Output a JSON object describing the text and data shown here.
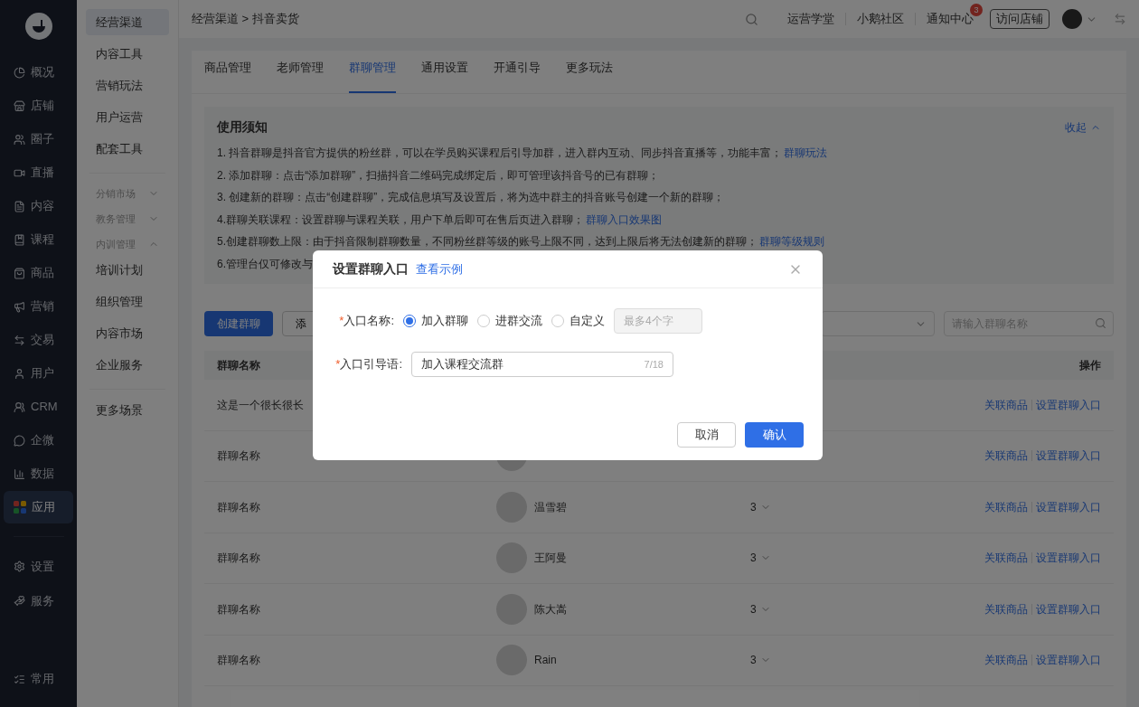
{
  "main_nav": {
    "items": [
      {
        "label": "概况",
        "selected": false
      },
      {
        "label": "店铺",
        "selected": false
      },
      {
        "label": "圈子",
        "selected": false
      },
      {
        "label": "直播",
        "selected": false
      },
      {
        "label": "内容",
        "selected": false
      },
      {
        "label": "课程",
        "selected": false
      },
      {
        "label": "商品",
        "selected": false
      },
      {
        "label": "营销",
        "selected": false
      },
      {
        "label": "交易",
        "selected": false
      },
      {
        "label": "用户",
        "selected": false
      },
      {
        "label": "CRM",
        "selected": false
      },
      {
        "label": "企微",
        "selected": false
      },
      {
        "label": "数据",
        "selected": false
      },
      {
        "label": "应用",
        "selected": true
      }
    ],
    "bottom_items": [
      {
        "label": "设置"
      },
      {
        "label": "服务"
      }
    ],
    "footer_item": {
      "label": "常用"
    }
  },
  "sub_nav": {
    "items": [
      {
        "label": "经营渠道",
        "selected": true
      },
      {
        "label": "内容工具",
        "selected": false
      },
      {
        "label": "营销玩法",
        "selected": false
      },
      {
        "label": "用户运营",
        "selected": false
      },
      {
        "label": "配套工具",
        "selected": false
      }
    ],
    "groups": [
      {
        "label": "分销市场",
        "expanded": false
      },
      {
        "label": "教务管理",
        "expanded": false
      },
      {
        "label": "内训管理",
        "expanded": true,
        "children": [
          {
            "label": "培训计划"
          },
          {
            "label": "组织管理"
          },
          {
            "label": "内容市场"
          },
          {
            "label": "企业服务"
          }
        ]
      }
    ],
    "extra_items": [
      {
        "label": "更多场景"
      }
    ]
  },
  "header": {
    "breadcrumb": "经营渠道 > 抖音卖货",
    "links": [
      "运营学堂",
      "小鹅社区"
    ],
    "notifications": {
      "label": "通知中心",
      "count": "3"
    },
    "visit_button": "访问店铺"
  },
  "tabs": [
    {
      "label": "商品管理",
      "selected": false
    },
    {
      "label": "老师管理",
      "selected": false
    },
    {
      "label": "群聊管理",
      "selected": true
    },
    {
      "label": "通用设置",
      "selected": false
    },
    {
      "label": "开通引导",
      "selected": false
    },
    {
      "label": "更多玩法",
      "selected": false
    }
  ],
  "notice": {
    "title": "使用须知",
    "collapse_label": "收起",
    "lines": [
      {
        "text": "1. 抖音群聊是抖音官方提供的粉丝群，可以在学员购买课程后引导加群，进入群内互动、同步抖音直播等，功能丰富；",
        "link": "群聊玩法"
      },
      {
        "text": "2. 添加群聊：点击“添加群聊”，扫描抖音二维码完成绑定后，即可管理该抖音号的已有群聊；"
      },
      {
        "text": "3. 创建新的群聊：点击“创建群聊”，完成信息填写及设置后，将为选中群主的抖音账号创建一个新的群聊；"
      },
      {
        "text": "4.群聊关联课程：设置群聊与课程关联，用户下单后即可在售后页进入群聊；",
        "link": "群聊入口效果图"
      },
      {
        "text": "5.创建群聊数上限：由于抖音限制群聊数量，不同粉丝群等级的账号上限不同，达到上限后将无法创建新的群聊；",
        "link": "群聊等级规则"
      },
      {
        "text": "6.管理台仅可修改与"
      }
    ]
  },
  "toolbar": {
    "create_button": "创建群聊",
    "add_button": "添",
    "search": {
      "placeholder": "请输入群聊名称"
    }
  },
  "table": {
    "columns": {
      "column_1": "群聊名称",
      "column_4": "操作"
    },
    "rows": [
      {
        "name": "这是一个很长很长",
        "avatar": false,
        "actions": [
          "关联商品",
          "设置群聊入口"
        ]
      },
      {
        "name": "群聊名称",
        "avatar": true,
        "actions": [
          "关联商品",
          "设置群聊入口"
        ]
      },
      {
        "name": "群聊名称",
        "avatar": true,
        "teacher": "温雪碧",
        "count": "3",
        "actions": [
          "关联商品",
          "设置群聊入口"
        ]
      },
      {
        "name": "群聊名称",
        "avatar": true,
        "teacher": "王阿曼",
        "count": "3",
        "actions": [
          "关联商品",
          "设置群聊入口"
        ]
      },
      {
        "name": "群聊名称",
        "avatar": true,
        "teacher": "陈大嵩",
        "count": "3",
        "actions": [
          "关联商品",
          "设置群聊入口"
        ]
      },
      {
        "name": "群聊名称",
        "avatar": true,
        "teacher": "Rain",
        "count": "3",
        "actions": [
          "关联商品",
          "设置群聊入口"
        ]
      }
    ]
  },
  "dialog": {
    "title": "设置群聊入口",
    "example_link": "查看示例",
    "name_field": {
      "required_mark": "*",
      "label": "入口名称:",
      "options": [
        {
          "label": "加入群聊",
          "selected": true
        },
        {
          "label": "进群交流",
          "selected": false
        },
        {
          "label": "自定义",
          "selected": false
        }
      ],
      "custom_placeholder": "最多4个字"
    },
    "guide_field": {
      "required_mark": "*",
      "label": "入口引导语:",
      "value": "加入课程交流群",
      "counter": "7/18"
    },
    "cancel_button": "取消",
    "confirm_button": "确认"
  }
}
